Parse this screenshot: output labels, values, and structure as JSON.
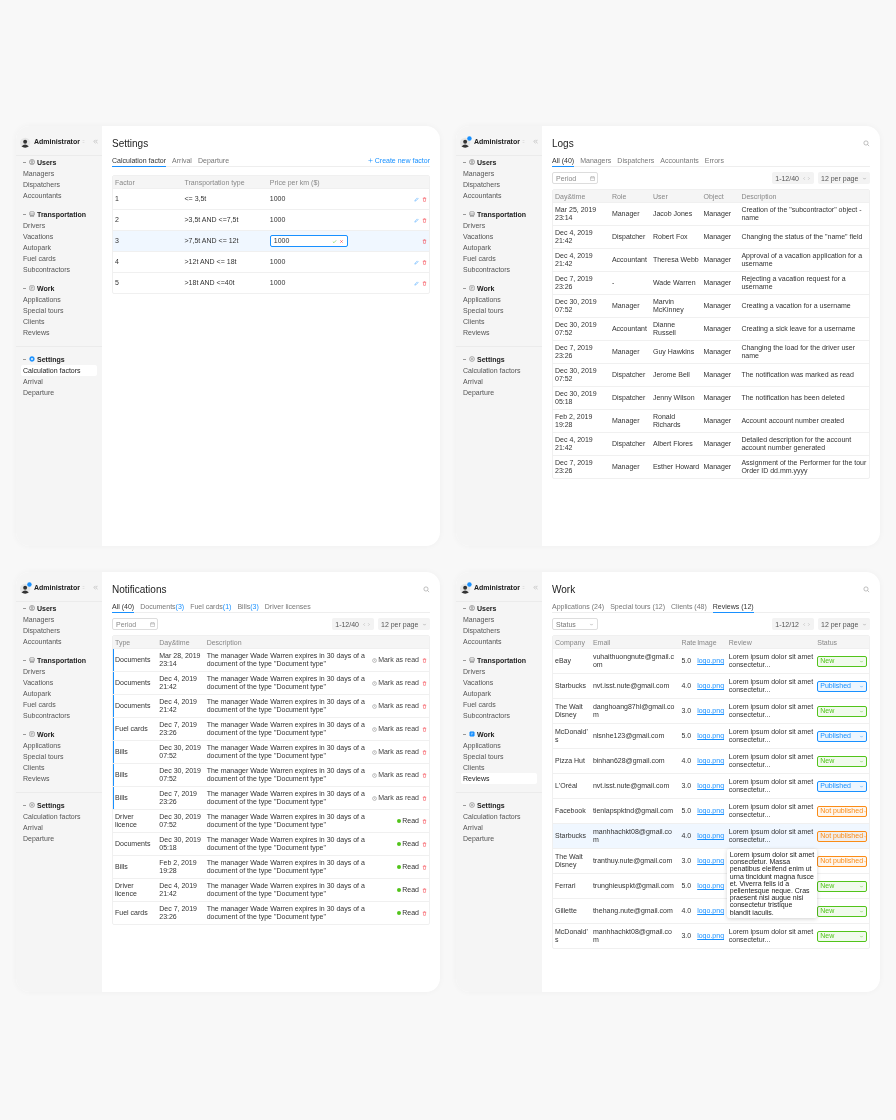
{
  "panels": [
    {
      "kind": "settings",
      "sidebar": {
        "user": "Administrator",
        "badge": false,
        "groups": [
          {
            "label": "Users",
            "active": false,
            "items": [
              {
                "label": "Managers",
                "selected": false
              },
              {
                "label": "Dispatchers",
                "selected": false
              },
              {
                "label": "Accountants",
                "selected": false
              }
            ]
          },
          {
            "label": "Transportation",
            "active": false,
            "items": [
              {
                "label": "Drivers",
                "selected": false
              },
              {
                "label": "Vacations",
                "selected": false
              },
              {
                "label": "Autopark",
                "selected": false
              },
              {
                "label": "Fuel cards",
                "selected": false
              },
              {
                "label": "Subcontractors",
                "selected": false
              }
            ]
          },
          {
            "label": "Work",
            "active": false,
            "items": [
              {
                "label": "Applications",
                "selected": false
              },
              {
                "label": "Special tours",
                "selected": false
              },
              {
                "label": "Clients",
                "selected": false
              },
              {
                "label": "Reviews",
                "selected": false
              }
            ]
          },
          {
            "label": "Settings",
            "active": true,
            "items": [
              {
                "label": "Calculation factors",
                "selected": true
              },
              {
                "label": "Arrival",
                "selected": false
              },
              {
                "label": "Departure",
                "selected": false
              }
            ]
          }
        ]
      },
      "title": "Settings",
      "tabs": [
        {
          "label": "Calculation factor",
          "selected": true
        },
        {
          "label": "Arrival",
          "selected": false
        },
        {
          "label": "Departure",
          "selected": false
        }
      ],
      "action": "Create new factor",
      "columns": [
        "Factor",
        "Transportation type",
        "Price per km ($)"
      ],
      "rows": [
        {
          "cells": [
            "1",
            "<= 3,5t",
            "1000"
          ],
          "editing": false
        },
        {
          "cells": [
            "2",
            ">3,5t AND <=7,5t",
            "1000"
          ],
          "editing": false
        },
        {
          "cells": [
            "3",
            ">7,5t AND <= 12t",
            "1000"
          ],
          "editing": true
        },
        {
          "cells": [
            "4",
            ">12t AND <= 18t",
            "1000"
          ],
          "editing": false
        },
        {
          "cells": [
            "5",
            ">18t AND <=40t",
            "1000"
          ],
          "editing": false
        }
      ]
    },
    {
      "kind": "logs",
      "sidebar": {
        "user": "Administrator",
        "badge": true,
        "groups": [
          {
            "label": "Users",
            "active": false,
            "items": [
              {
                "label": "Managers",
                "selected": false
              },
              {
                "label": "Dispatchers",
                "selected": false
              },
              {
                "label": "Accountants",
                "selected": false
              }
            ]
          },
          {
            "label": "Transportation",
            "active": false,
            "items": [
              {
                "label": "Drivers",
                "selected": false
              },
              {
                "label": "Vacations",
                "selected": false
              },
              {
                "label": "Autopark",
                "selected": false
              },
              {
                "label": "Fuel cards",
                "selected": false
              },
              {
                "label": "Subcontractors",
                "selected": false
              }
            ]
          },
          {
            "label": "Work",
            "active": false,
            "items": [
              {
                "label": "Applications",
                "selected": false
              },
              {
                "label": "Special tours",
                "selected": false
              },
              {
                "label": "Clients",
                "selected": false
              },
              {
                "label": "Reviews",
                "selected": false
              }
            ]
          },
          {
            "label": "Settings",
            "active": false,
            "items": [
              {
                "label": "Calculation factors",
                "selected": false
              },
              {
                "label": "Arrival",
                "selected": false
              },
              {
                "label": "Departure",
                "selected": false
              }
            ]
          }
        ]
      },
      "title": "Logs",
      "tabs": [
        {
          "label": "All (40)",
          "selected": true
        },
        {
          "label": "Managers",
          "selected": false
        },
        {
          "label": "Dispatchers",
          "selected": false
        },
        {
          "label": "Accountants",
          "selected": false
        },
        {
          "label": "Errors",
          "selected": false
        }
      ],
      "filter": {
        "kind": "date",
        "placeholder": "Period"
      },
      "range": "1-12/40",
      "per_page": "12 per page",
      "columns": [
        "Day&time",
        "Role",
        "User",
        "Object",
        "Description"
      ],
      "rows": [
        {
          "cells": [
            "Mar 25, 2019 23:14",
            "Manager",
            "Jacob Jones",
            "Manager",
            "Creation of the \"subcontractor\" object - name"
          ]
        },
        {
          "cells": [
            "Dec 4, 2019 21:42",
            "Dispatcher",
            "Robert Fox",
            "Manager",
            "Changing the status of the \"name\" field"
          ]
        },
        {
          "cells": [
            "Dec 4, 2019 21:42",
            "Accountant",
            "Theresa Webb",
            "Manager",
            "Approval of a vacation application for a username"
          ]
        },
        {
          "cells": [
            "Dec 7, 2019 23:26",
            "-",
            "Wade Warren",
            "Manager",
            "Rejecting a vacation request for a username"
          ]
        },
        {
          "cells": [
            "Dec 30, 2019 07:52",
            "Manager",
            "Marvin McKinney",
            "Manager",
            "Creating a vacation for a username"
          ]
        },
        {
          "cells": [
            "Dec 30, 2019 07:52",
            "Accountant",
            "Dianne Russell",
            "Manager",
            "Creating a sick leave for a username"
          ]
        },
        {
          "cells": [
            "Dec 7, 2019 23:26",
            "Manager",
            "Guy Hawkins",
            "Manager",
            "Changing the load for the driver user name"
          ]
        },
        {
          "cells": [
            "Dec 30, 2019 07:52",
            "Dispatcher",
            "Jerome Bell",
            "Manager",
            "The notification was marked as read"
          ]
        },
        {
          "cells": [
            "Dec 30, 2019 05:18",
            "Dispatcher",
            "Jenny Wilson",
            "Manager",
            "The notification has been deleted"
          ]
        },
        {
          "cells": [
            "Feb 2, 2019 19:28",
            "Manager",
            "Ronald Richards",
            "Manager",
            "Account account number created"
          ]
        },
        {
          "cells": [
            "Dec 4, 2019 21:42",
            "Dispatcher",
            "Albert Flores",
            "Manager",
            "Detailed description for the account account number generated"
          ]
        },
        {
          "cells": [
            "Dec 7, 2019 23:26",
            "Manager",
            "Esther Howard",
            "Manager",
            "Assignment of the Performer for the tour Order ID dd.mm.yyyy"
          ]
        }
      ]
    },
    {
      "kind": "notifications",
      "sidebar": {
        "user": "Administrator",
        "badge": true,
        "groups": [
          {
            "label": "Users",
            "active": false,
            "items": [
              {
                "label": "Managers",
                "selected": false
              },
              {
                "label": "Dispatchers",
                "selected": false
              },
              {
                "label": "Accountants",
                "selected": false
              }
            ]
          },
          {
            "label": "Transportation",
            "active": false,
            "items": [
              {
                "label": "Drivers",
                "selected": false
              },
              {
                "label": "Vacations",
                "selected": false
              },
              {
                "label": "Autopark",
                "selected": false
              },
              {
                "label": "Fuel cards",
                "selected": false
              },
              {
                "label": "Subcontractors",
                "selected": false
              }
            ]
          },
          {
            "label": "Work",
            "active": false,
            "items": [
              {
                "label": "Applications",
                "selected": false
              },
              {
                "label": "Special tours",
                "selected": false
              },
              {
                "label": "Clients",
                "selected": false
              },
              {
                "label": "Reviews",
                "selected": false
              }
            ]
          },
          {
            "label": "Settings",
            "active": false,
            "items": [
              {
                "label": "Calculation factors",
                "selected": false
              },
              {
                "label": "Arrival",
                "selected": false
              },
              {
                "label": "Departure",
                "selected": false
              }
            ]
          }
        ]
      },
      "title": "Notifications",
      "tabs": [
        {
          "label": "All (40)",
          "selected": true
        },
        {
          "label": "Documents",
          "count": "(3)",
          "selected": false
        },
        {
          "label": "Fuel cards",
          "count": "(1)",
          "selected": false
        },
        {
          "label": "Bills",
          "count": "(3)",
          "selected": false
        },
        {
          "label": "Driver licenses",
          "selected": false
        }
      ],
      "filter": {
        "kind": "date",
        "placeholder": "Period"
      },
      "range": "1-12/40",
      "per_page": "12 per page",
      "columns": [
        "Type",
        "Day&time",
        "Description"
      ],
      "rows": [
        {
          "cells": [
            "Documents",
            "Mar 28, 2019 23:14",
            "The manager Wade Warren expires in 30 days of a document of the type \"Document type\""
          ],
          "read": false,
          "action": "Mark as read"
        },
        {
          "cells": [
            "Documents",
            "Dec 4, 2019 21:42",
            "The manager Wade Warren expires in 30 days of a document of the type \"Document type\""
          ],
          "read": false,
          "action": "Mark as read"
        },
        {
          "cells": [
            "Documents",
            "Dec 4, 2019 21:42",
            "The manager Wade Warren expires in 30 days of a document of the type \"Document type\""
          ],
          "read": false,
          "action": "Mark as read"
        },
        {
          "cells": [
            "Fuel cards",
            "Dec 7, 2019 23:26",
            "The manager Wade Warren expires in 30 days of a document of the type \"Document type\""
          ],
          "read": false,
          "action": "Mark as read"
        },
        {
          "cells": [
            "Bills",
            "Dec 30, 2019 07:52",
            "The manager Wade Warren expires in 30 days of a document of the type \"Document type\""
          ],
          "read": false,
          "action": "Mark as read"
        },
        {
          "cells": [
            "Bills",
            "Dec 30, 2019 07:52",
            "The manager Wade Warren expires in 30 days of a document of the type \"Document type\""
          ],
          "read": false,
          "action": "Mark as read"
        },
        {
          "cells": [
            "Bills",
            "Dec 7, 2019 23:26",
            "The manager Wade Warren expires in 30 days of a document of the type \"Document type\""
          ],
          "read": false,
          "action": "Mark as read"
        },
        {
          "cells": [
            "Driver licence",
            "Dec 30, 2019 07:52",
            "The manager Wade Warren expires in 30 days of a document of the type \"Document type\""
          ],
          "read": true,
          "action": "Read"
        },
        {
          "cells": [
            "Documents",
            "Dec 30, 2019 05:18",
            "The manager Wade Warren expires in 30 days of a document of the type \"Document type\""
          ],
          "read": true,
          "action": "Read"
        },
        {
          "cells": [
            "Bills",
            "Feb 2, 2019 19:28",
            "The manager Wade Warren expires in 30 days of a document of the type \"Document type\""
          ],
          "read": true,
          "action": "Read"
        },
        {
          "cells": [
            "Driver licence",
            "Dec 4, 2019 21:42",
            "The manager Wade Warren expires in 30 days of a document of the type \"Document type\""
          ],
          "read": true,
          "action": "Read"
        },
        {
          "cells": [
            "Fuel cards",
            "Dec 7, 2019 23:26",
            "The manager Wade Warren expires in 30 days of a document of the type \"Document type\""
          ],
          "read": true,
          "action": "Read"
        }
      ]
    },
    {
      "kind": "reviews",
      "sidebar": {
        "user": "Administrator",
        "badge": true,
        "groups": [
          {
            "label": "Users",
            "active": false,
            "items": [
              {
                "label": "Managers",
                "selected": false
              },
              {
                "label": "Dispatchers",
                "selected": false
              },
              {
                "label": "Accountants",
                "selected": false
              }
            ]
          },
          {
            "label": "Transportation",
            "active": false,
            "items": [
              {
                "label": "Drivers",
                "selected": false
              },
              {
                "label": "Vacations",
                "selected": false
              },
              {
                "label": "Autopark",
                "selected": false
              },
              {
                "label": "Fuel cards",
                "selected": false
              },
              {
                "label": "Subcontractors",
                "selected": false
              }
            ]
          },
          {
            "label": "Work",
            "active": true,
            "items": [
              {
                "label": "Applications",
                "selected": false
              },
              {
                "label": "Special tours",
                "selected": false
              },
              {
                "label": "Clients",
                "selected": false
              },
              {
                "label": "Reviews",
                "selected": true
              }
            ]
          },
          {
            "label": "Settings",
            "active": false,
            "items": [
              {
                "label": "Calculation factors",
                "selected": false
              },
              {
                "label": "Arrival",
                "selected": false
              },
              {
                "label": "Departure",
                "selected": false
              }
            ]
          }
        ]
      },
      "title": "Work",
      "tabs": [
        {
          "label": "Applications (24)",
          "selected": false
        },
        {
          "label": "Special tours (12)",
          "selected": false
        },
        {
          "label": "Clients (48)",
          "selected": false
        },
        {
          "label": "Reviews (12)",
          "selected": true
        }
      ],
      "filter": {
        "kind": "select",
        "value": "Status"
      },
      "range": "1-12/12",
      "per_page": "12 per page",
      "columns": [
        "Company",
        "Email",
        "Rate",
        "Image",
        "Review",
        "Status"
      ],
      "rows": [
        {
          "cells": [
            "eBay",
            "vuhaithuongnute@gmail.com",
            "5.0"
          ],
          "image": "logo.png",
          "review": "Lorem ipsum dolor sit amet consectetur...",
          "status": "New",
          "color": "#52c41a",
          "highlighted": false
        },
        {
          "cells": [
            "Starbucks",
            "nvt.isst.nute@gmail.com",
            "4.0"
          ],
          "image": "logo.png",
          "review": "Lorem ipsum dolor sit amet consectetur...",
          "status": "Published",
          "color": "#1890ff",
          "highlighted": false
        },
        {
          "cells": [
            "The Walt Disney",
            "danghoang87hl@gmail.com",
            "3.0"
          ],
          "image": "logo.png",
          "review": "Lorem ipsum dolor sit amet consectetur...",
          "status": "New",
          "color": "#52c41a",
          "highlighted": false
        },
        {
          "cells": [
            "McDonald's",
            "nlsnhe123@gmail.com",
            "5.0"
          ],
          "image": "logo.png",
          "review": "Lorem ipsum dolor sit amet consectetur...",
          "status": "Published",
          "color": "#1890ff",
          "highlighted": false
        },
        {
          "cells": [
            "Pizza Hut",
            "binhan628@gmail.com",
            "4.0"
          ],
          "image": "logo.png",
          "review": "Lorem ipsum dolor sit amet consectetur...",
          "status": "New",
          "color": "#52c41a",
          "highlighted": false
        },
        {
          "cells": [
            "L'Oréal",
            "nvt.isst.nute@gmail.com",
            "3.0"
          ],
          "image": "logo.png",
          "review": "Lorem ipsum dolor sit amet consectetur...",
          "status": "Published",
          "color": "#1890ff",
          "highlighted": false
        },
        {
          "cells": [
            "Facebook",
            "tienlapspktnd@gmail.com",
            "5.0"
          ],
          "image": "logo.png",
          "review": "Lorem ipsum dolor sit amet consectetur...",
          "status": "Not published",
          "color": "#fa8c16",
          "highlighted": false
        },
        {
          "cells": [
            "Starbucks",
            "manhhachkt08@gmail.com",
            "4.0"
          ],
          "image": "logo.png",
          "review": "Lorem ipsum dolor sit amet consectetur...",
          "status": "Not published",
          "color": "#fa8c16",
          "highlighted": true
        },
        {
          "cells": [
            "The Walt Disney",
            "tranthuy.nute@gmail.com",
            "3.0"
          ],
          "image": "logo.png",
          "status": "Not published",
          "color": "#fa8c16",
          "highlighted": false
        },
        {
          "cells": [
            "Ferrari",
            "trunghieuspkt@gmail.com",
            "5.0"
          ],
          "image": "logo.png",
          "status": "New",
          "color": "#52c41a",
          "highlighted": false
        },
        {
          "cells": [
            "Gillette",
            "thehang.nute@gmail.com",
            "4.0"
          ],
          "image": "logo.png",
          "status": "New",
          "color": "#52c41a",
          "highlighted": false
        },
        {
          "cells": [
            "McDonald's",
            "manhhachkt08@gmail.com",
            "3.0"
          ],
          "image": "logo.png",
          "review": "Lorem ipsum dolor sit amet consectetur...",
          "status": "New",
          "color": "#52c41a",
          "highlighted": false
        }
      ],
      "tooltip": "Lorem ipsum dolor sit amet consectetur. Massa penatibus eleifend enim ut urna tincidunt magna fusce et. Viverra felis id a pellentesque neque. Cras praesent nisi augue nisi consectetur tristique blandit iaculis."
    }
  ]
}
